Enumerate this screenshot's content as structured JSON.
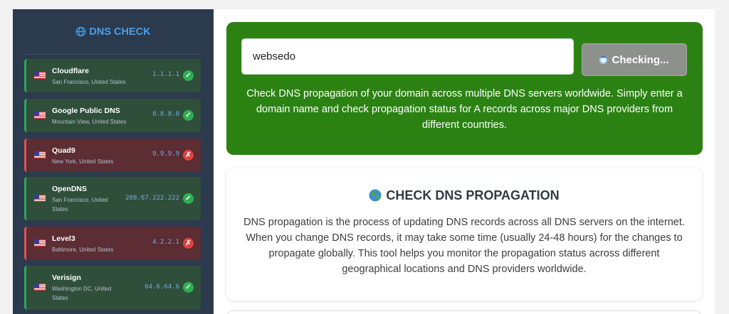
{
  "sidebar": {
    "title": "DNS CHECK",
    "title_icon": "globe-icon",
    "servers": [
      {
        "name": "Cloudflare",
        "location": "San Francisco, United States",
        "ip": "1.1.1.1",
        "status": "ok",
        "status_glyph": "✓"
      },
      {
        "name": "Google Public DNS",
        "location": "Mountain View, United States",
        "ip": "8.8.8.8",
        "status": "ok",
        "status_glyph": "✓"
      },
      {
        "name": "Quad9",
        "location": "New York, United States",
        "ip": "9.9.9.9",
        "status": "fail",
        "status_glyph": "✗"
      },
      {
        "name": "OpenDNS",
        "location": "San Francisco, United States",
        "ip": "208.67.222.222",
        "status": "ok",
        "status_glyph": "✓"
      },
      {
        "name": "Level3",
        "location": "Baltimore, United States",
        "ip": "4.2.2.1",
        "status": "fail",
        "status_glyph": "✗"
      },
      {
        "name": "Verisign",
        "location": "Washington DC, United States",
        "ip": "64.6.64.6",
        "status": "ok",
        "status_glyph": "✓"
      }
    ]
  },
  "search": {
    "value": "websedo",
    "button_label": "Checking..."
  },
  "hero": {
    "description": "Check DNS propagation of your domain across multiple DNS servers worldwide. Simply enter a domain name and check propagation status for A records across major DNS providers from different countries."
  },
  "info": {
    "title": "CHECK DNS PROPAGATION",
    "title_icon": "earth-globe-icon",
    "description": "DNS propagation is the process of updating DNS records across all DNS servers on the internet. When you change DNS records, it may take some time (usually 24-48 hours) for the changes to propagate globally. This tool helps you monitor the propagation status across different geographical locations and DNS providers worldwide."
  },
  "colors": {
    "sidebar_bg": "#2c3a4e",
    "ok_card": "#2f4f3b",
    "fail_card": "#5c2d33",
    "hero_green": "#2b8213",
    "accent_blue": "#4a9fe8"
  }
}
